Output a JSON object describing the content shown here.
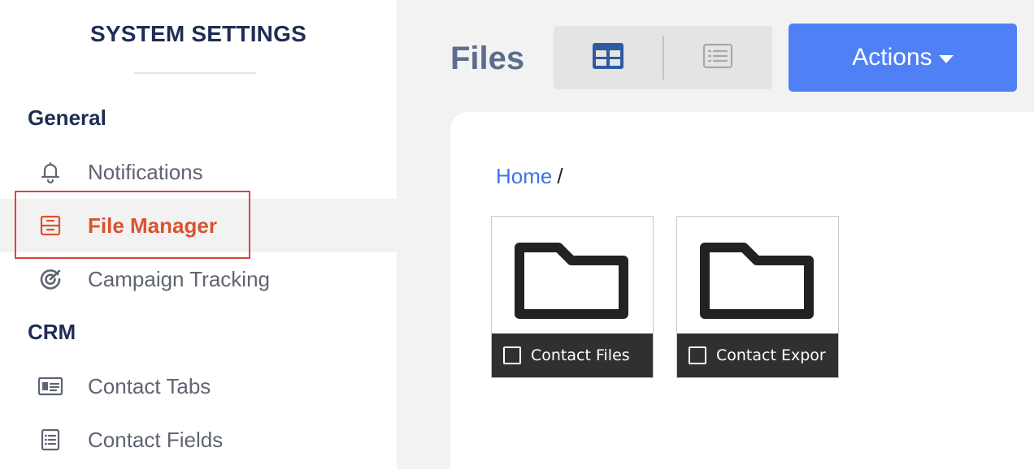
{
  "sidebar": {
    "title": "SYSTEM SETTINGS",
    "sections": [
      {
        "heading": "General",
        "items": [
          {
            "label": "Notifications",
            "icon": "bell-icon",
            "active": false
          },
          {
            "label": "File Manager",
            "icon": "file-cabinet-icon",
            "active": true
          },
          {
            "label": "Campaign Tracking",
            "icon": "target-icon",
            "active": false
          }
        ]
      },
      {
        "heading": "CRM",
        "items": [
          {
            "label": "Contact Tabs",
            "icon": "contact-card-icon",
            "active": false
          },
          {
            "label": "Contact Fields",
            "icon": "list-icon",
            "active": false
          }
        ]
      }
    ]
  },
  "header": {
    "title": "Files",
    "view_modes": [
      "grid-view-icon",
      "list-view-icon"
    ],
    "actions_label": "Actions"
  },
  "breadcrumb": {
    "home": "Home",
    "separator": "/"
  },
  "folders": [
    {
      "name": "Contact Files"
    },
    {
      "name": "Contact Expor"
    }
  ],
  "colors": {
    "accent": "#4f80f5",
    "active_nav": "#d9532e",
    "heading": "#1f2d54",
    "highlight_border": "#d9453a"
  }
}
